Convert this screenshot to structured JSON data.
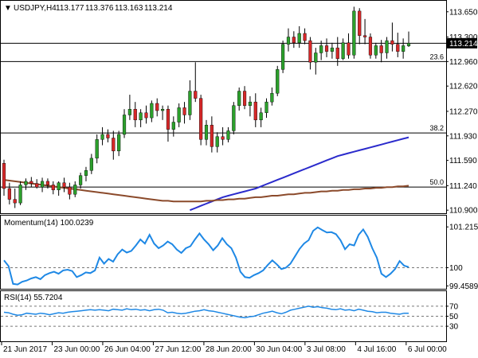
{
  "header": {
    "arrow": "▼",
    "symbol": "USDJPY,H4",
    "open": "113.177",
    "high": "113.376",
    "low": "113.163",
    "close": "113.214"
  },
  "chart_data": [
    {
      "type": "candlestick",
      "title": "USDJPY,H4",
      "ylim": [
        110.88,
        113.78
      ],
      "y_ticks": [
        "113.650",
        "113.300",
        "112.960",
        "112.620",
        "112.270",
        "111.930",
        "111.590",
        "111.240",
        "110.900"
      ],
      "current_price": "113.214",
      "x_ticks": [
        "21 Jun 2017",
        "23 Jun 00:00",
        "26 Jun 04:00",
        "27 Jun 12:00",
        "28 Jun 20:00",
        "30 Jun 04:00",
        "3 Jul 08:00",
        "4 Jul 16:00",
        "6 Jul 00:00"
      ],
      "fibonacci": [
        {
          "label": "23.6",
          "value": 112.96
        },
        {
          "label": "38.2",
          "value": 111.97
        },
        {
          "label": "50.0",
          "value": 111.22
        }
      ],
      "horizontal_lines": [
        113.214
      ],
      "colors": {
        "bull": "#2ca02c",
        "bear": "#d62728",
        "wick": "#000000",
        "ma_fast": "#2b2bcc",
        "ma_slow": "#8b4a2b"
      },
      "candles": [
        {
          "o": 111.55,
          "h": 111.6,
          "l": 111.1,
          "c": 111.2
        },
        {
          "o": 111.2,
          "h": 111.28,
          "l": 110.98,
          "c": 111.05
        },
        {
          "o": 111.05,
          "h": 111.2,
          "l": 110.93,
          "c": 111.0
        },
        {
          "o": 111.0,
          "h": 111.3,
          "l": 110.97,
          "c": 111.25
        },
        {
          "o": 111.25,
          "h": 111.34,
          "l": 111.18,
          "c": 111.3
        },
        {
          "o": 111.3,
          "h": 111.36,
          "l": 111.22,
          "c": 111.27
        },
        {
          "o": 111.27,
          "h": 111.33,
          "l": 111.2,
          "c": 111.22
        },
        {
          "o": 111.22,
          "h": 111.35,
          "l": 111.15,
          "c": 111.3
        },
        {
          "o": 111.3,
          "h": 111.34,
          "l": 111.2,
          "c": 111.25
        },
        {
          "o": 111.25,
          "h": 111.3,
          "l": 111.12,
          "c": 111.18
        },
        {
          "o": 111.18,
          "h": 111.3,
          "l": 111.1,
          "c": 111.28
        },
        {
          "o": 111.28,
          "h": 111.35,
          "l": 111.15,
          "c": 111.22
        },
        {
          "o": 111.22,
          "h": 111.28,
          "l": 111.05,
          "c": 111.12
        },
        {
          "o": 111.12,
          "h": 111.3,
          "l": 111.08,
          "c": 111.25
        },
        {
          "o": 111.25,
          "h": 111.42,
          "l": 111.2,
          "c": 111.38
        },
        {
          "o": 111.38,
          "h": 111.5,
          "l": 111.3,
          "c": 111.45
        },
        {
          "o": 111.45,
          "h": 111.68,
          "l": 111.4,
          "c": 111.62
        },
        {
          "o": 111.62,
          "h": 111.95,
          "l": 111.55,
          "c": 111.88
        },
        {
          "o": 111.88,
          "h": 112.05,
          "l": 111.8,
          "c": 111.95
        },
        {
          "o": 111.95,
          "h": 112.02,
          "l": 111.84,
          "c": 111.9
        },
        {
          "o": 111.9,
          "h": 112.0,
          "l": 111.6,
          "c": 111.72
        },
        {
          "o": 111.72,
          "h": 112.0,
          "l": 111.65,
          "c": 111.95
        },
        {
          "o": 111.95,
          "h": 112.3,
          "l": 111.9,
          "c": 112.22
        },
        {
          "o": 112.22,
          "h": 112.5,
          "l": 112.15,
          "c": 112.3
        },
        {
          "o": 112.3,
          "h": 112.4,
          "l": 112.05,
          "c": 112.15
        },
        {
          "o": 112.15,
          "h": 112.3,
          "l": 112.05,
          "c": 112.25
        },
        {
          "o": 112.25,
          "h": 112.35,
          "l": 112.1,
          "c": 112.18
        },
        {
          "o": 112.18,
          "h": 112.42,
          "l": 112.12,
          "c": 112.38
        },
        {
          "o": 112.38,
          "h": 112.45,
          "l": 112.2,
          "c": 112.28
        },
        {
          "o": 112.28,
          "h": 112.35,
          "l": 112.15,
          "c": 112.3
        },
        {
          "o": 112.3,
          "h": 112.35,
          "l": 111.85,
          "c": 112.02
        },
        {
          "o": 112.02,
          "h": 112.2,
          "l": 111.92,
          "c": 112.12
        },
        {
          "o": 112.12,
          "h": 112.38,
          "l": 112.05,
          "c": 112.32
        },
        {
          "o": 112.32,
          "h": 112.4,
          "l": 112.1,
          "c": 112.22
        },
        {
          "o": 112.22,
          "h": 112.7,
          "l": 112.15,
          "c": 112.55
        },
        {
          "o": 112.55,
          "h": 112.95,
          "l": 112.4,
          "c": 112.45
        },
        {
          "o": 112.45,
          "h": 112.5,
          "l": 111.8,
          "c": 111.88
        },
        {
          "o": 111.88,
          "h": 112.15,
          "l": 111.8,
          "c": 112.08
        },
        {
          "o": 112.08,
          "h": 112.2,
          "l": 111.7,
          "c": 111.78
        },
        {
          "o": 111.78,
          "h": 111.98,
          "l": 111.7,
          "c": 111.92
        },
        {
          "o": 111.92,
          "h": 112.05,
          "l": 111.8,
          "c": 111.88
        },
        {
          "o": 111.88,
          "h": 112.05,
          "l": 111.84,
          "c": 112.0
        },
        {
          "o": 112.0,
          "h": 112.4,
          "l": 111.95,
          "c": 112.35
        },
        {
          "o": 112.35,
          "h": 112.6,
          "l": 112.28,
          "c": 112.55
        },
        {
          "o": 112.55,
          "h": 112.62,
          "l": 112.3,
          "c": 112.35
        },
        {
          "o": 112.35,
          "h": 112.48,
          "l": 112.2,
          "c": 112.4
        },
        {
          "o": 112.4,
          "h": 112.52,
          "l": 112.05,
          "c": 112.15
        },
        {
          "o": 112.15,
          "h": 112.32,
          "l": 112.05,
          "c": 112.25
        },
        {
          "o": 112.25,
          "h": 112.45,
          "l": 112.18,
          "c": 112.4
        },
        {
          "o": 112.4,
          "h": 112.6,
          "l": 112.35,
          "c": 112.52
        },
        {
          "o": 112.52,
          "h": 112.9,
          "l": 112.48,
          "c": 112.85
        },
        {
          "o": 112.85,
          "h": 113.25,
          "l": 112.8,
          "c": 113.2
        },
        {
          "o": 113.2,
          "h": 113.42,
          "l": 113.1,
          "c": 113.3
        },
        {
          "o": 113.3,
          "h": 113.38,
          "l": 113.15,
          "c": 113.22
        },
        {
          "o": 113.22,
          "h": 113.45,
          "l": 113.15,
          "c": 113.35
        },
        {
          "o": 113.35,
          "h": 113.42,
          "l": 113.2,
          "c": 113.25
        },
        {
          "o": 113.25,
          "h": 113.3,
          "l": 112.85,
          "c": 112.95
        },
        {
          "o": 112.95,
          "h": 113.15,
          "l": 112.78,
          "c": 113.08
        },
        {
          "o": 113.08,
          "h": 113.25,
          "l": 112.98,
          "c": 113.18
        },
        {
          "o": 113.18,
          "h": 113.28,
          "l": 113.02,
          "c": 113.1
        },
        {
          "o": 113.1,
          "h": 113.22,
          "l": 113.0,
          "c": 113.15
        },
        {
          "o": 113.15,
          "h": 113.3,
          "l": 112.9,
          "c": 113.0
        },
        {
          "o": 113.0,
          "h": 113.28,
          "l": 112.98,
          "c": 113.22
        },
        {
          "o": 113.22,
          "h": 113.35,
          "l": 113.0,
          "c": 113.05
        },
        {
          "o": 113.05,
          "h": 113.72,
          "l": 113.0,
          "c": 113.66
        },
        {
          "o": 113.66,
          "h": 113.7,
          "l": 113.2,
          "c": 113.32
        },
        {
          "o": 113.32,
          "h": 113.55,
          "l": 113.2,
          "c": 113.3
        },
        {
          "o": 113.3,
          "h": 113.35,
          "l": 113.0,
          "c": 113.05
        },
        {
          "o": 113.05,
          "h": 113.22,
          "l": 113.0,
          "c": 113.18
        },
        {
          "o": 113.18,
          "h": 113.26,
          "l": 112.95,
          "c": 113.08
        },
        {
          "o": 113.08,
          "h": 113.3,
          "l": 113.0,
          "c": 113.25
        },
        {
          "o": 113.25,
          "h": 113.5,
          "l": 113.1,
          "c": 113.2
        },
        {
          "o": 113.2,
          "h": 113.36,
          "l": 113.02,
          "c": 113.1
        },
        {
          "o": 113.1,
          "h": 113.28,
          "l": 113.0,
          "c": 113.18
        },
        {
          "o": 113.177,
          "h": 113.376,
          "l": 113.163,
          "c": 113.214
        }
      ],
      "series": [
        {
          "values": [
            null,
            null,
            null,
            null,
            null,
            null,
            null,
            null,
            null,
            null,
            null,
            null,
            null,
            null,
            null,
            null,
            null,
            null,
            null,
            null,
            null,
            null,
            null,
            null,
            null,
            null,
            null,
            null,
            null,
            null,
            null,
            null,
            null,
            null,
            110.9,
            110.93,
            110.96,
            110.99,
            111.02,
            111.05,
            111.08,
            111.1,
            111.12,
            111.14,
            111.16,
            111.18,
            111.2,
            111.23,
            111.26,
            111.29,
            111.32,
            111.35,
            111.38,
            111.41,
            111.44,
            111.47,
            111.5,
            111.53,
            111.56,
            111.59,
            111.62,
            111.65,
            111.67,
            111.69,
            111.71,
            111.73,
            111.75,
            111.77,
            111.79,
            111.81,
            111.83,
            111.85,
            111.87,
            111.89,
            111.91
          ]
        },
        {
          "values": [
            111.32,
            111.31,
            111.3,
            111.29,
            111.28,
            111.27,
            111.26,
            111.25,
            111.24,
            111.23,
            111.22,
            111.21,
            111.2,
            111.19,
            111.18,
            111.17,
            111.16,
            111.15,
            111.14,
            111.13,
            111.12,
            111.11,
            111.1,
            111.09,
            111.08,
            111.07,
            111.06,
            111.05,
            111.04,
            111.03,
            111.03,
            111.02,
            111.02,
            111.02,
            111.02,
            111.02,
            111.02,
            111.03,
            111.03,
            111.04,
            111.04,
            111.05,
            111.05,
            111.06,
            111.06,
            111.07,
            111.08,
            111.08,
            111.09,
            111.1,
            111.1,
            111.11,
            111.12,
            111.12,
            111.13,
            111.14,
            111.14,
            111.15,
            111.16,
            111.16,
            111.17,
            111.17,
            111.18,
            111.18,
            111.19,
            111.19,
            111.2,
            111.2,
            111.21,
            111.21,
            111.22,
            111.22,
            111.23,
            111.23,
            111.24
          ]
        }
      ]
    },
    {
      "type": "line",
      "title": "Momentum(14) 100.0239",
      "ylim": [
        99.42,
        101.22
      ],
      "y_ticks": [
        "101.2151",
        "100",
        "99.4589"
      ],
      "reference_lines": [
        100
      ],
      "series": [
        {
          "values": [
            100.22,
            100.05,
            99.52,
            99.5,
            99.58,
            99.62,
            99.68,
            99.72,
            99.66,
            99.78,
            99.84,
            99.88,
            99.82,
            99.92,
            99.94,
            99.9,
            99.72,
            99.78,
            99.86,
            99.84,
            99.92,
            100.3,
            100.12,
            100.26,
            100.18,
            100.4,
            100.54,
            100.45,
            100.5,
            100.66,
            100.84,
            100.72,
            100.98,
            100.72,
            100.58,
            100.66,
            100.78,
            100.7,
            100.54,
            100.44,
            100.58,
            100.64,
            100.84,
            101.02,
            100.84,
            100.7,
            100.52,
            100.66,
            100.88,
            100.7,
            100.58,
            100.3,
            99.88,
            99.72,
            99.7,
            99.78,
            99.84,
            99.92,
            100.08,
            100.22,
            100.1,
            99.96,
            100.0,
            100.12,
            100.34,
            100.56,
            100.72,
            100.82,
            101.1,
            101.2,
            101.12,
            101.05,
            101.06,
            101.0,
            100.82,
            100.55,
            100.7,
            100.66,
            100.98,
            101.14,
            100.92,
            100.58,
            100.3,
            99.82,
            99.72,
            99.82,
            99.96,
            100.2,
            100.06,
            100.02
          ]
        }
      ]
    },
    {
      "type": "line",
      "title": "RSI(14) 55.7204",
      "ylim": [
        0,
        100
      ],
      "y_ticks": [
        "70",
        "50",
        "30"
      ],
      "reference_lines": [
        70,
        50,
        30
      ],
      "series": [
        {
          "values": [
            58,
            57,
            54,
            52,
            53,
            56,
            55,
            54,
            56,
            55,
            53,
            55,
            57,
            56,
            58,
            59,
            60,
            61,
            62,
            63,
            62,
            63,
            62,
            61,
            64,
            63,
            62,
            65,
            63,
            64,
            62,
            63,
            61,
            63,
            64,
            62,
            57,
            58,
            56,
            55,
            56,
            58,
            60,
            61,
            63,
            61,
            60,
            58,
            56,
            54,
            52,
            50,
            48,
            47,
            49,
            50,
            53,
            56,
            58,
            60,
            57,
            55,
            58,
            62,
            64,
            66,
            68,
            70,
            68,
            69,
            67,
            66,
            64,
            63,
            65,
            62,
            63,
            61,
            64,
            62,
            60,
            59,
            57,
            58,
            58,
            56,
            55,
            54,
            56,
            56
          ]
        }
      ]
    }
  ]
}
